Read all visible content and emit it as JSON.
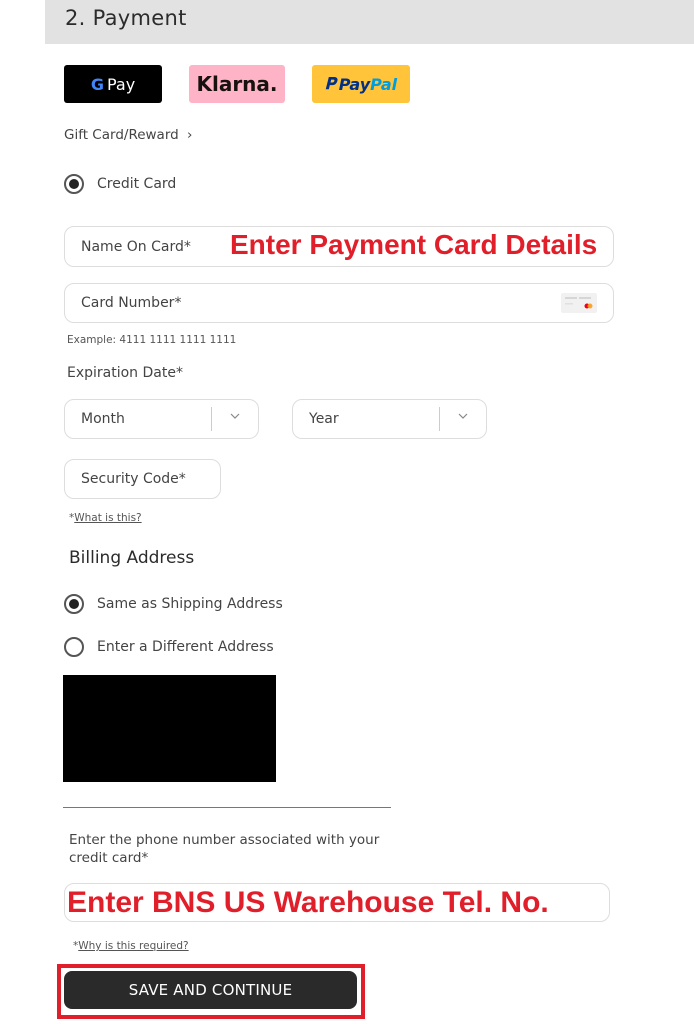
{
  "section": {
    "title": "2. Payment"
  },
  "wallets": {
    "gpay": {
      "g": "G",
      "label": "Pay"
    },
    "klarna": {
      "label": "Klarna."
    },
    "paypal": {
      "label_a": "Pay",
      "label_b": "Pal"
    }
  },
  "gift_card_link": "Gift Card/Reward",
  "payment_method": {
    "label": "Credit Card",
    "selected": true
  },
  "fields": {
    "name_on_card": {
      "placeholder": "Name On Card*"
    },
    "card_number": {
      "placeholder": "Card Number*",
      "icon": "credit-card-icon"
    },
    "card_example": "Example: 4111 1111 1111 1111",
    "expiration_label": "Expiration Date*",
    "month": {
      "placeholder": "Month"
    },
    "year": {
      "placeholder": "Year"
    },
    "security_code": {
      "placeholder": "Security Code*"
    },
    "security_help_prefix": "*",
    "security_help_link": "What is this?"
  },
  "billing": {
    "title": "Billing Address",
    "options": [
      {
        "label": "Same as Shipping Address",
        "selected": true
      },
      {
        "label": "Enter a Different Address",
        "selected": false
      }
    ]
  },
  "phone": {
    "label": "Enter the phone number associated with your credit card*",
    "help_prefix": "*",
    "help_link": "Why is this required?"
  },
  "annotations": {
    "card_details": "Enter Payment Card Details",
    "phone": "Enter BNS US Warehouse Tel. No."
  },
  "colors": {
    "annotation": "#e01f2a",
    "button": "#2a2a2a",
    "header_bg": "#e2e2e2"
  },
  "save_button": {
    "label": "SAVE AND CONTINUE"
  }
}
